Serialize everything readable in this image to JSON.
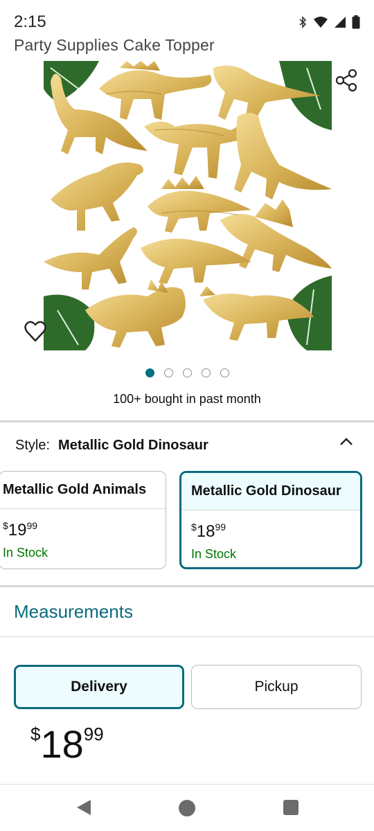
{
  "status_bar": {
    "time": "2:15",
    "icons": [
      "bluetooth-icon",
      "wifi-icon",
      "signal-icon",
      "battery-icon"
    ]
  },
  "product": {
    "title": "Party Supplies Cake Topper",
    "image_description_icon": "gold-dinosaur-figurines-image",
    "image_count": 5,
    "current_image_index": 0,
    "social_proof": "100+ bought in past month"
  },
  "style_selector": {
    "label": "Style:",
    "selected_value": "Metallic Gold Dinosaur",
    "options": [
      {
        "name": "Metallic Gold Animals",
        "price_symbol": "$",
        "price_whole": "19",
        "price_cents": "99",
        "stock": "In Stock",
        "selected": false
      },
      {
        "name": "Metallic Gold Dinosaur",
        "price_symbol": "$",
        "price_whole": "18",
        "price_cents": "99",
        "stock": "In Stock",
        "selected": true
      }
    ]
  },
  "measurements": {
    "label": "Measurements"
  },
  "fulfillment": {
    "delivery_label": "Delivery",
    "pickup_label": "Pickup",
    "selected": "Delivery"
  },
  "price": {
    "symbol": "$",
    "whole": "18",
    "cents": "99"
  },
  "colors": {
    "teal": "#0a6b7c",
    "in_stock_green": "#007600",
    "selected_bg": "#edfdff",
    "gold": "#d9b45a",
    "leaf_green": "#2e6b2a"
  }
}
